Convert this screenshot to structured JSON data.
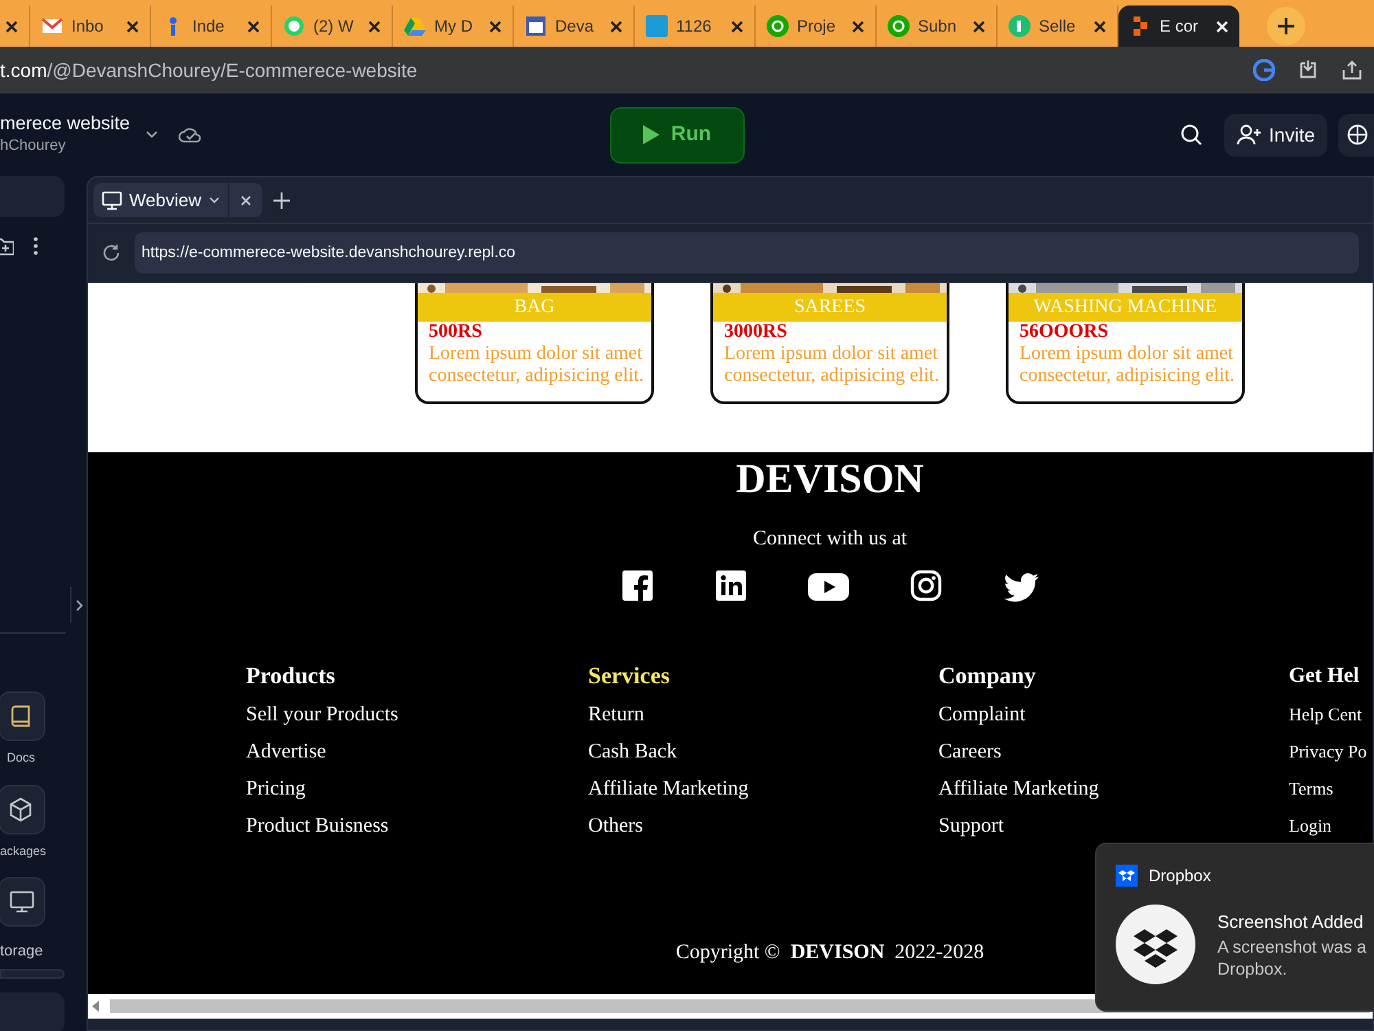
{
  "browser_tabs": [
    {
      "kind": "none",
      "selected": false
    },
    {
      "kind": "mail",
      "title": "Inbo",
      "selected": false
    },
    {
      "kind": "pin",
      "title": "Inde",
      "selected": false
    },
    {
      "kind": "chat",
      "title": "(2) W",
      "selected": false
    },
    {
      "kind": "drive",
      "title": "My D",
      "selected": false
    },
    {
      "kind": "calendar",
      "title": "Deva",
      "selected": false
    },
    {
      "kind": "square",
      "title": "1126",
      "selected": false
    },
    {
      "kind": "circle",
      "title": "Proje",
      "selected": false
    },
    {
      "kind": "circle",
      "title": "Subn",
      "selected": false
    },
    {
      "kind": "leaf",
      "title": "Selle",
      "selected": false
    },
    {
      "kind": "replit",
      "title": "E cor",
      "selected": true
    }
  ],
  "address_bar": {
    "host": "t.com",
    "path": "/@DevanshChourey/E-commerece-website"
  },
  "project": {
    "name": "merece website",
    "owner": "hChourey"
  },
  "run_button": "Run",
  "invite_button": "Invite",
  "sidebar": {
    "tools": [
      {
        "kind": "book",
        "label": "Docs"
      },
      {
        "kind": "cube",
        "label": "ackages"
      },
      {
        "kind": "monitor",
        "label": "torage"
      }
    ]
  },
  "webview": {
    "tab": "Webview",
    "url": "https://e-commerece-website.devanshchourey.repl.co"
  },
  "products": [
    {
      "name": "BAG",
      "price": "500RS",
      "description": "Lorem ipsum dolor sit amet consectetur, adipisicing elit."
    },
    {
      "name": "SAREES",
      "price": "3000RS",
      "description": "Lorem ipsum dolor sit amet consectetur, adipisicing elit."
    },
    {
      "name": "WASHING MACHINE",
      "price": "56OOORS",
      "description": "Lorem ipsum dolor sit amet consectetur, adipisicing elit."
    }
  ],
  "footer": {
    "brand": "DEVISON",
    "connect": "Connect with us at",
    "socials": [
      {
        "kind": "facebook"
      },
      {
        "kind": "linkedin"
      },
      {
        "kind": "youtube"
      },
      {
        "kind": "instagram"
      },
      {
        "kind": "twitter"
      }
    ],
    "columns": [
      {
        "heading": "Products",
        "highlighted": false,
        "links": [
          "Sell your Products",
          "Advertise",
          "Pricing",
          "Product Buisness"
        ]
      },
      {
        "heading": "Services",
        "highlighted": true,
        "links": [
          "Return",
          "Cash Back",
          "Affiliate Marketing",
          "Others"
        ]
      },
      {
        "heading": "Company",
        "highlighted": false,
        "links": [
          "Complaint",
          "Careers",
          "Affiliate Marketing",
          "Support"
        ]
      },
      {
        "heading": "Get Hel",
        "highlighted": false,
        "links": [
          "Help Cent",
          "Privacy Po",
          "Terms",
          "Login"
        ]
      }
    ],
    "copyright": "Copyright ©  **DEVISON**  2022-2028"
  },
  "notification": {
    "app": "Dropbox",
    "title": "Screenshot Added",
    "lines": [
      "A screenshot was a",
      "Dropbox."
    ]
  }
}
